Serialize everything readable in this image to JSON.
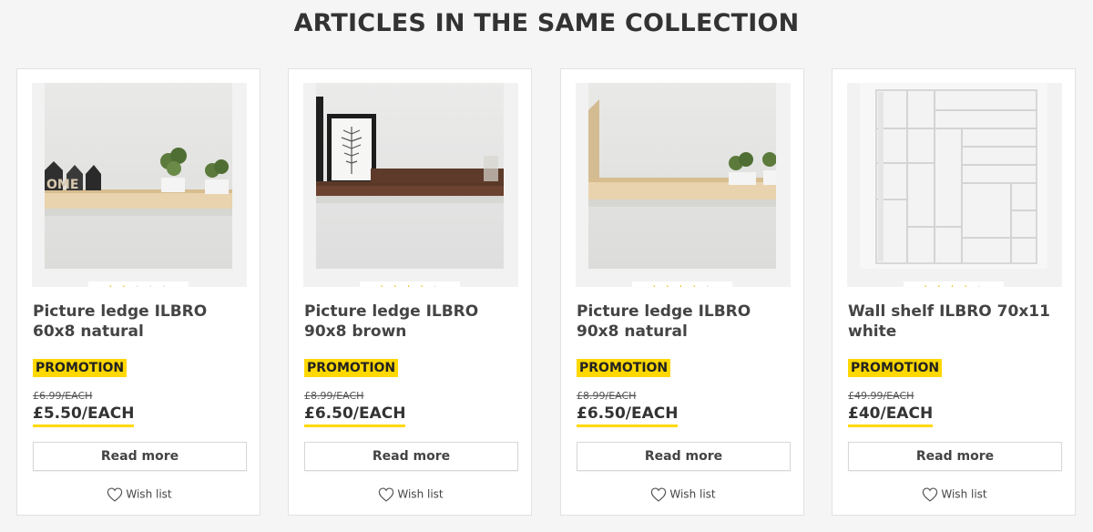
{
  "section": {
    "title": "ARTICLES IN THE SAME COLLECTION"
  },
  "accent_color": "#ffd800",
  "star_color": "#f5b200",
  "products": [
    {
      "name": "Picture ledge ILBRO 60x8 natural",
      "rating": 2,
      "badge": "PROMOTION",
      "old_price": "£6.99/EACH",
      "price": "£5.50/EACH",
      "read_more": "Read more",
      "wishlist": "Wish list",
      "image_icon": "natural-shelf-with-plants-image"
    },
    {
      "name": "Picture ledge ILBRO 90x8 brown",
      "rating": 4,
      "badge": "PROMOTION",
      "old_price": "£8.99/EACH",
      "price": "£6.50/EACH",
      "read_more": "Read more",
      "wishlist": "Wish list",
      "image_icon": "brown-shelf-with-frame-image"
    },
    {
      "name": "Picture ledge ILBRO 90x8 natural",
      "rating": 4,
      "badge": "PROMOTION",
      "old_price": "£8.99/EACH",
      "price": "£6.50/EACH",
      "read_more": "Read more",
      "wishlist": "Wish list",
      "image_icon": "natural-shelf-with-plants-image"
    },
    {
      "name": "Wall shelf ILBRO 70x11 white",
      "rating": 3.5,
      "badge": "PROMOTION",
      "old_price": "£49.99/EACH",
      "price": "£40/EACH",
      "read_more": "Read more",
      "wishlist": "Wish list",
      "image_icon": "white-wall-shelf-image"
    }
  ]
}
